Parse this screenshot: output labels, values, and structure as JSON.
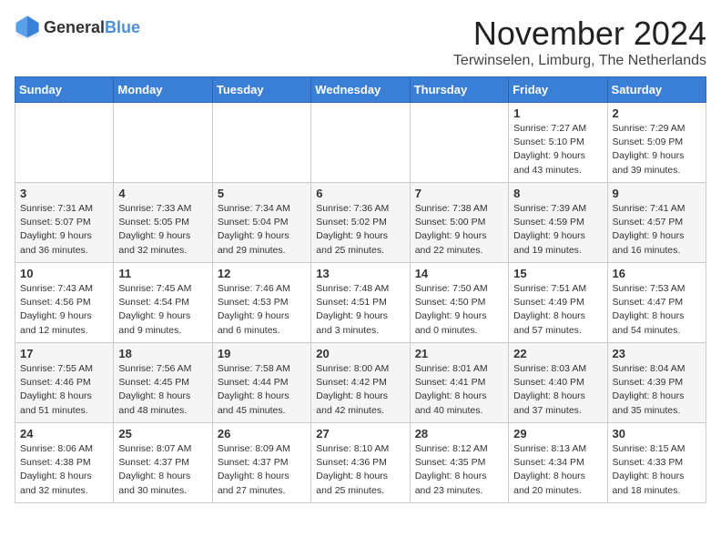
{
  "logo": {
    "text_general": "General",
    "text_blue": "Blue"
  },
  "title": "November 2024",
  "location": "Terwinselen, Limburg, The Netherlands",
  "weekdays": [
    "Sunday",
    "Monday",
    "Tuesday",
    "Wednesday",
    "Thursday",
    "Friday",
    "Saturday"
  ],
  "weeks": [
    [
      {
        "day": "",
        "info": ""
      },
      {
        "day": "",
        "info": ""
      },
      {
        "day": "",
        "info": ""
      },
      {
        "day": "",
        "info": ""
      },
      {
        "day": "",
        "info": ""
      },
      {
        "day": "1",
        "info": "Sunrise: 7:27 AM\nSunset: 5:10 PM\nDaylight: 9 hours and 43 minutes."
      },
      {
        "day": "2",
        "info": "Sunrise: 7:29 AM\nSunset: 5:09 PM\nDaylight: 9 hours and 39 minutes."
      }
    ],
    [
      {
        "day": "3",
        "info": "Sunrise: 7:31 AM\nSunset: 5:07 PM\nDaylight: 9 hours and 36 minutes."
      },
      {
        "day": "4",
        "info": "Sunrise: 7:33 AM\nSunset: 5:05 PM\nDaylight: 9 hours and 32 minutes."
      },
      {
        "day": "5",
        "info": "Sunrise: 7:34 AM\nSunset: 5:04 PM\nDaylight: 9 hours and 29 minutes."
      },
      {
        "day": "6",
        "info": "Sunrise: 7:36 AM\nSunset: 5:02 PM\nDaylight: 9 hours and 25 minutes."
      },
      {
        "day": "7",
        "info": "Sunrise: 7:38 AM\nSunset: 5:00 PM\nDaylight: 9 hours and 22 minutes."
      },
      {
        "day": "8",
        "info": "Sunrise: 7:39 AM\nSunset: 4:59 PM\nDaylight: 9 hours and 19 minutes."
      },
      {
        "day": "9",
        "info": "Sunrise: 7:41 AM\nSunset: 4:57 PM\nDaylight: 9 hours and 16 minutes."
      }
    ],
    [
      {
        "day": "10",
        "info": "Sunrise: 7:43 AM\nSunset: 4:56 PM\nDaylight: 9 hours and 12 minutes."
      },
      {
        "day": "11",
        "info": "Sunrise: 7:45 AM\nSunset: 4:54 PM\nDaylight: 9 hours and 9 minutes."
      },
      {
        "day": "12",
        "info": "Sunrise: 7:46 AM\nSunset: 4:53 PM\nDaylight: 9 hours and 6 minutes."
      },
      {
        "day": "13",
        "info": "Sunrise: 7:48 AM\nSunset: 4:51 PM\nDaylight: 9 hours and 3 minutes."
      },
      {
        "day": "14",
        "info": "Sunrise: 7:50 AM\nSunset: 4:50 PM\nDaylight: 9 hours and 0 minutes."
      },
      {
        "day": "15",
        "info": "Sunrise: 7:51 AM\nSunset: 4:49 PM\nDaylight: 8 hours and 57 minutes."
      },
      {
        "day": "16",
        "info": "Sunrise: 7:53 AM\nSunset: 4:47 PM\nDaylight: 8 hours and 54 minutes."
      }
    ],
    [
      {
        "day": "17",
        "info": "Sunrise: 7:55 AM\nSunset: 4:46 PM\nDaylight: 8 hours and 51 minutes."
      },
      {
        "day": "18",
        "info": "Sunrise: 7:56 AM\nSunset: 4:45 PM\nDaylight: 8 hours and 48 minutes."
      },
      {
        "day": "19",
        "info": "Sunrise: 7:58 AM\nSunset: 4:44 PM\nDaylight: 8 hours and 45 minutes."
      },
      {
        "day": "20",
        "info": "Sunrise: 8:00 AM\nSunset: 4:42 PM\nDaylight: 8 hours and 42 minutes."
      },
      {
        "day": "21",
        "info": "Sunrise: 8:01 AM\nSunset: 4:41 PM\nDaylight: 8 hours and 40 minutes."
      },
      {
        "day": "22",
        "info": "Sunrise: 8:03 AM\nSunset: 4:40 PM\nDaylight: 8 hours and 37 minutes."
      },
      {
        "day": "23",
        "info": "Sunrise: 8:04 AM\nSunset: 4:39 PM\nDaylight: 8 hours and 35 minutes."
      }
    ],
    [
      {
        "day": "24",
        "info": "Sunrise: 8:06 AM\nSunset: 4:38 PM\nDaylight: 8 hours and 32 minutes."
      },
      {
        "day": "25",
        "info": "Sunrise: 8:07 AM\nSunset: 4:37 PM\nDaylight: 8 hours and 30 minutes."
      },
      {
        "day": "26",
        "info": "Sunrise: 8:09 AM\nSunset: 4:37 PM\nDaylight: 8 hours and 27 minutes."
      },
      {
        "day": "27",
        "info": "Sunrise: 8:10 AM\nSunset: 4:36 PM\nDaylight: 8 hours and 25 minutes."
      },
      {
        "day": "28",
        "info": "Sunrise: 8:12 AM\nSunset: 4:35 PM\nDaylight: 8 hours and 23 minutes."
      },
      {
        "day": "29",
        "info": "Sunrise: 8:13 AM\nSunset: 4:34 PM\nDaylight: 8 hours and 20 minutes."
      },
      {
        "day": "30",
        "info": "Sunrise: 8:15 AM\nSunset: 4:33 PM\nDaylight: 8 hours and 18 minutes."
      }
    ]
  ]
}
